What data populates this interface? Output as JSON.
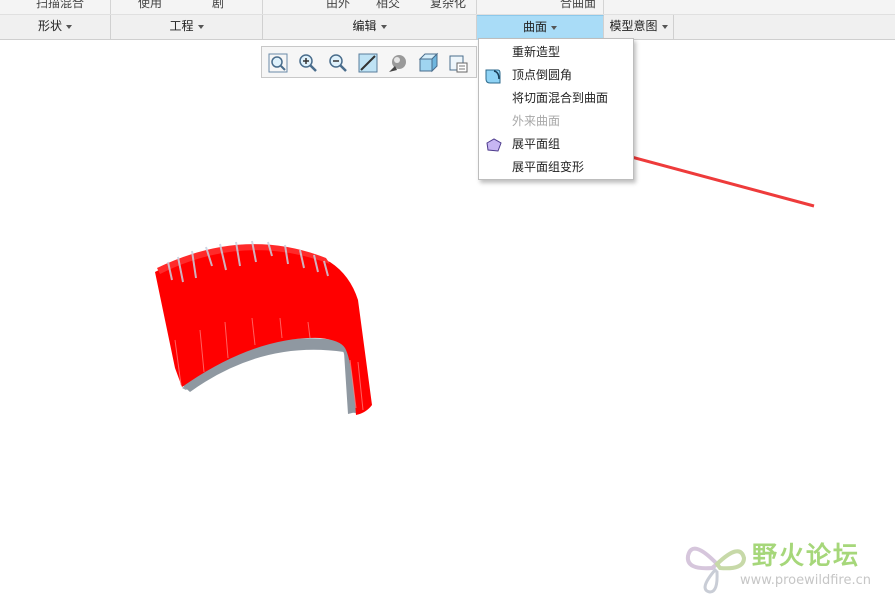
{
  "ribbon_top_fragments": [
    "扫描混合",
    "使用",
    "剧",
    "由外",
    "相交",
    "复杂化",
    "合曲面"
  ],
  "groups": [
    {
      "label": "形状"
    },
    {
      "label": "工程"
    },
    {
      "label": "编辑"
    },
    {
      "label": "曲面"
    },
    {
      "label": "模型意图"
    }
  ],
  "view_toolbar": {
    "buttons": [
      "refit-icon",
      "zoom-in-icon",
      "zoom-out-icon",
      "repaint-icon",
      "display-style-icon",
      "saved-views-icon",
      "view-manager-icon"
    ]
  },
  "surface_menu": {
    "items": [
      {
        "label": "重新造型",
        "icon": "",
        "disabled": false
      },
      {
        "label": "顶点倒圆角",
        "icon": "vertex-round-icon",
        "disabled": false
      },
      {
        "label": "将切面混合到曲面",
        "icon": "",
        "disabled": false
      },
      {
        "label": "外来曲面",
        "icon": "",
        "disabled": true
      },
      {
        "label": "展平面组",
        "icon": "flatten-quilt-icon",
        "disabled": false
      },
      {
        "label": "展平面组变形",
        "icon": "",
        "disabled": false
      }
    ]
  },
  "model": {
    "surface_color": "#ff0000",
    "edge_color": "#8a9aa8"
  },
  "annotation": {
    "arrow_color": "#ee3b3b"
  },
  "watermark": {
    "title": "野火论坛",
    "url": "www.proewildfire.cn"
  }
}
